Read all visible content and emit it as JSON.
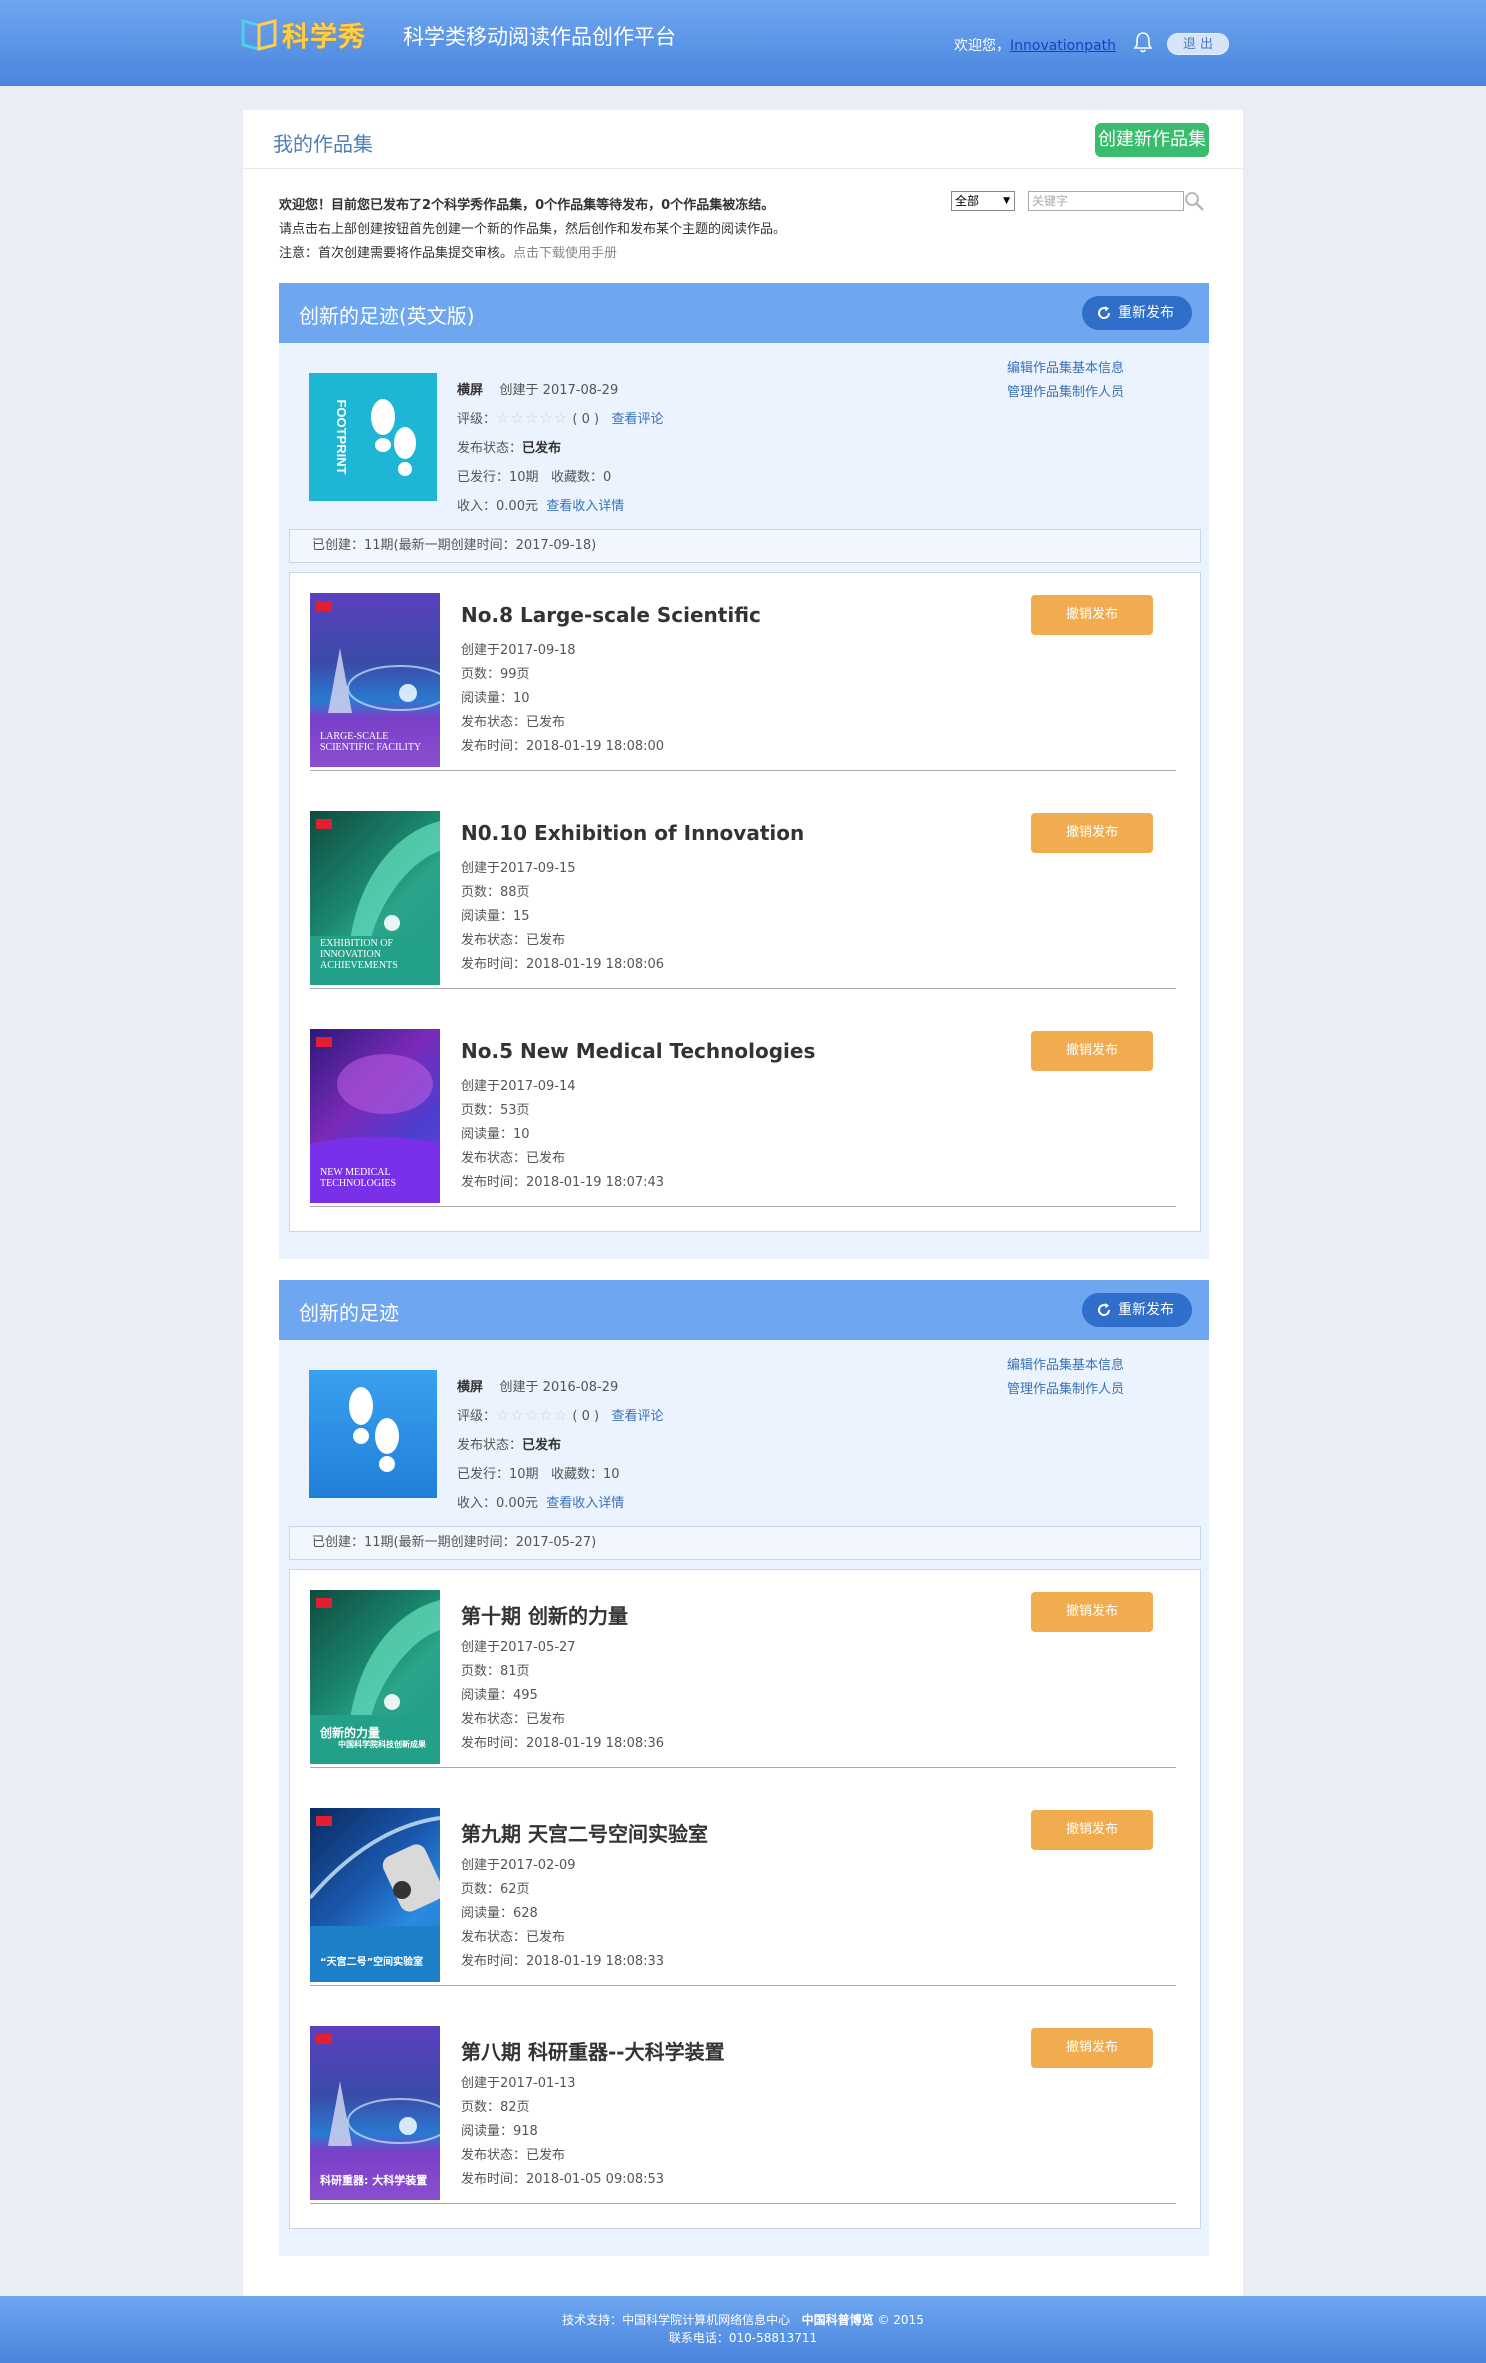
{
  "header": {
    "logo_text": "科学秀",
    "site_title": "科学类移动阅读作品创作平台",
    "welcome_prefix": "欢迎您，",
    "username": "Innovationpath",
    "logout_label": "退 出"
  },
  "page": {
    "title": "我的作品集",
    "create_label": "创建新作品集",
    "intro_line1_prefix": "欢迎您！目前您已发布了",
    "intro_published": "2",
    "intro_line1_mid1": "个科学秀作品集，",
    "intro_pending": "0",
    "intro_line1_mid2": "个作品集等待发布，",
    "intro_frozen": "0",
    "intro_line1_suffix": "个作品集被冻结。",
    "intro_line2": "请点击右上部创建按钮首先创建一个新的作品集，然后创作和发布某个主题的阅读作品。",
    "intro_line3": "注意：首次创建需要将作品集提交审核。",
    "manual_link": "点击下载使用手册",
    "filter_value": "全部",
    "search_placeholder": "关键字"
  },
  "labels": {
    "republish": "重新发布",
    "screen": "横屏",
    "rating": "评级：",
    "view_comments": "查看评论",
    "status": "发布状态：",
    "issued": "已发行：",
    "favorites": "收藏数：",
    "income": "收入：",
    "income_details": "查看收入详情",
    "edit_info": "编辑作品集基本信息",
    "manage_staff": "管理作品集制作人员",
    "unpublish": "撤销发布",
    "stars": "☆☆☆☆☆"
  },
  "collections": [
    {
      "name": "创新的足迹(英文版)",
      "created": "创建于 2017-08-29",
      "rating_count": "( 0 )",
      "status": "已发布",
      "issued": "10期",
      "favorites": "0",
      "income": "0.00元",
      "created_bar": "已创建：11期(最新一期创建时间：2017-09-18)",
      "thumb_text": "FOOTPRINT",
      "issues": [
        {
          "title": "No.8 Large-scale Scientific",
          "created": "创建于2017-09-18",
          "pages": "页数：99页",
          "reads": "阅读量：10",
          "status": "发布状态：已发布",
          "pubtime": "发布时间：2018-01-19 18:08:00",
          "cover_line1": "LARGE-SCALE",
          "cover_line2": "SCIENTIFIC FACILITY"
        },
        {
          "title": "N0.10 Exhibition of Innovation",
          "created": "创建于2017-09-15",
          "pages": "页数：88页",
          "reads": "阅读量：15",
          "status": "发布状态：已发布",
          "pubtime": "发布时间：2018-01-19 18:08:06",
          "cover_line1": "EXHIBITION OF",
          "cover_line2": "INNOVATION ACHIEVEMENTS"
        },
        {
          "title": "No.5 New Medical Technologies",
          "created": "创建于2017-09-14",
          "pages": "页数：53页",
          "reads": "阅读量：10",
          "status": "发布状态：已发布",
          "pubtime": "发布时间：2018-01-19 18:07:43",
          "cover_line1": "NEW MEDICAL",
          "cover_line2": "TECHNOLOGIES"
        }
      ]
    },
    {
      "name": "创新的足迹",
      "created": "创建于 2016-08-29",
      "rating_count": "( 0 )",
      "status": "已发布",
      "issued": "10期",
      "favorites": "10",
      "income": "0.00元",
      "created_bar": "已创建：11期(最新一期创建时间：2017-05-27)",
      "issues": [
        {
          "title": "第十期 创新的力量",
          "created": "创建于2017-05-27",
          "pages": "页数：81页",
          "reads": "阅读量：495",
          "status": "发布状态：已发布",
          "pubtime": "发布时间：2018-01-19 18:08:36",
          "cover_line1": "创新的力量",
          "cover_line2": "中国科学院科技创新成果"
        },
        {
          "title": "第九期 天宫二号空间实验室",
          "created": "创建于2017-02-09",
          "pages": "页数：62页",
          "reads": "阅读量：628",
          "status": "发布状态：已发布",
          "pubtime": "发布时间：2018-01-19 18:08:33",
          "cover_line1": "“天宫二号”空间实验室",
          "cover_line2": ""
        },
        {
          "title": "第八期 科研重器--大科学装置",
          "created": "创建于2017-01-13",
          "pages": "页数：82页",
          "reads": "阅读量：918",
          "status": "发布状态：已发布",
          "pubtime": "发布时间：2018-01-05 09:08:53",
          "cover_line1": "科研重器: 大科学装置",
          "cover_line2": ""
        }
      ]
    }
  ],
  "footer": {
    "line1_prefix": "技术支持：中国科学院计算机网络信息中心",
    "line1_brand": "中国科普博览",
    "line1_suffix": "© 2015",
    "line2": "联系电话：010-58813711"
  },
  "colors": {
    "header_blue": "#5d97e8",
    "collection_head": "#6ea6ef",
    "republish_btn": "#2f6ec9",
    "create_btn": "#3bbb6e",
    "unpublish_btn": "#f0ac4e",
    "link": "#3b71b8"
  }
}
